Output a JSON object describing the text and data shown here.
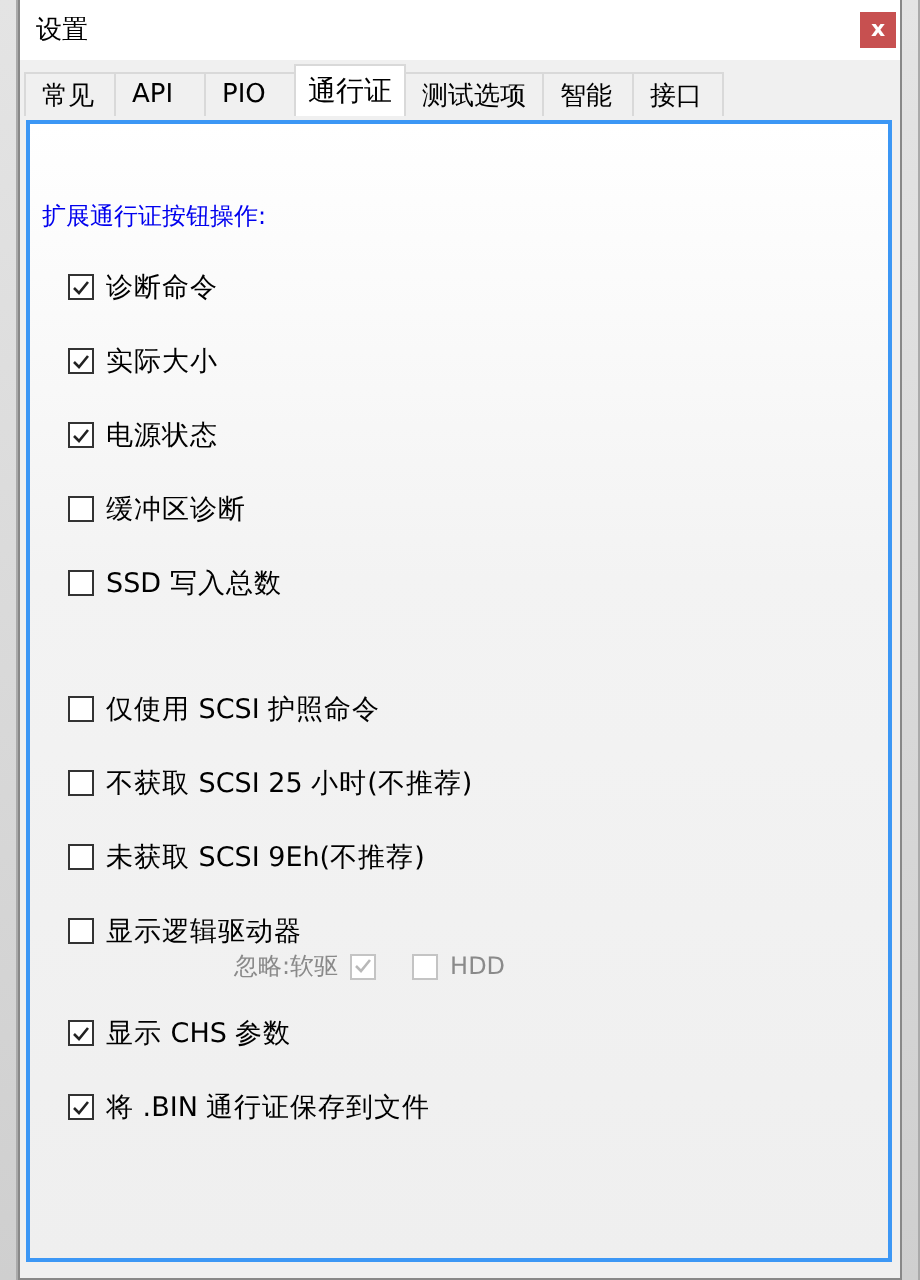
{
  "window": {
    "title": "设置",
    "close": "x"
  },
  "tabs": [
    {
      "label": "常见",
      "selected": false
    },
    {
      "label": "API",
      "selected": false
    },
    {
      "label": "PIO",
      "selected": false
    },
    {
      "label": "通行证",
      "selected": true
    },
    {
      "label": "测试选项",
      "selected": false
    },
    {
      "label": "智能",
      "selected": false
    },
    {
      "label": "接口",
      "selected": false
    }
  ],
  "heading": "扩展通行证按钮操作:",
  "option_groups": [
    [
      {
        "label": "诊断命令",
        "checked": true
      },
      {
        "label": "实际大小",
        "checked": true
      },
      {
        "label": "电源状态",
        "checked": true
      },
      {
        "label": "缓冲区诊断",
        "checked": false
      },
      {
        "label": "SSD 写入总数",
        "checked": false
      }
    ],
    [
      {
        "label": "仅使用 SCSI 护照命令",
        "checked": false
      },
      {
        "label": "不获取 SCSI 25 小时(不推荐)",
        "checked": false
      },
      {
        "label": "未获取 SCSI 9Eh(不推荐)",
        "checked": false
      },
      {
        "label": "显示逻辑驱动器",
        "checked": false,
        "sub_options": [
          {
            "kind": "label-before",
            "label": "忽略:软驱",
            "checked": true,
            "disabled": true
          },
          {
            "kind": "label-after",
            "label": "HDD",
            "checked": false,
            "disabled": true
          }
        ]
      },
      {
        "label": "显示 CHS 参数",
        "checked": true
      },
      {
        "label": "将 .BIN 通行证保存到文件",
        "checked": true
      }
    ]
  ]
}
